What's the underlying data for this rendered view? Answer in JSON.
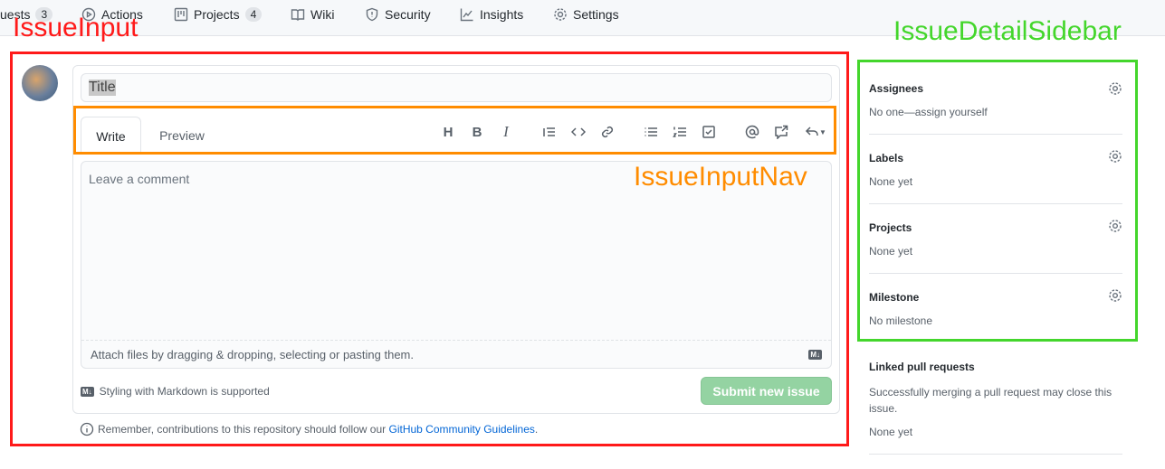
{
  "nav": {
    "items": [
      {
        "label": "uests",
        "count": "3",
        "icon": "git-pull-request-icon"
      },
      {
        "label": "Actions",
        "icon": "play-icon"
      },
      {
        "label": "Projects",
        "count": "4",
        "icon": "project-icon"
      },
      {
        "label": "Wiki",
        "icon": "book-icon"
      },
      {
        "label": "Security",
        "icon": "shield-icon"
      },
      {
        "label": "Insights",
        "icon": "graph-icon"
      },
      {
        "label": "Settings",
        "icon": "gear-icon"
      }
    ]
  },
  "annotations": {
    "issue_input": "IssueInput",
    "issue_input_nav": "IssueInputNav",
    "sidebar": "IssueDetailSidebar",
    "colors": {
      "red": "#ff1a1a",
      "orange": "#ff8c00",
      "green": "#44d62c"
    }
  },
  "form": {
    "title_placeholder": "Title",
    "tab_write": "Write",
    "tab_preview": "Preview",
    "comment_placeholder": "Leave a comment",
    "attach_text": "Attach files by dragging & dropping, selecting or pasting them.",
    "md_badge": "M↓",
    "markdown_note": "Styling with Markdown is supported",
    "submit_label": "Submit new issue",
    "remember_text": "Remember, contributions to this repository should follow our ",
    "guidelines_link": "GitHub Community Guidelines",
    "period": "."
  },
  "toolbar": {
    "heading": "H",
    "bold": "B",
    "italic": "I"
  },
  "sidebar": {
    "sections": [
      {
        "title": "Assignees",
        "value": "No one—assign yourself"
      },
      {
        "title": "Labels",
        "value": "None yet"
      },
      {
        "title": "Projects",
        "value": "None yet"
      },
      {
        "title": "Milestone",
        "value": "No milestone"
      }
    ],
    "linked": {
      "title": "Linked pull requests",
      "desc": "Successfully merging a pull request may close this issue.",
      "value": "None yet"
    }
  }
}
